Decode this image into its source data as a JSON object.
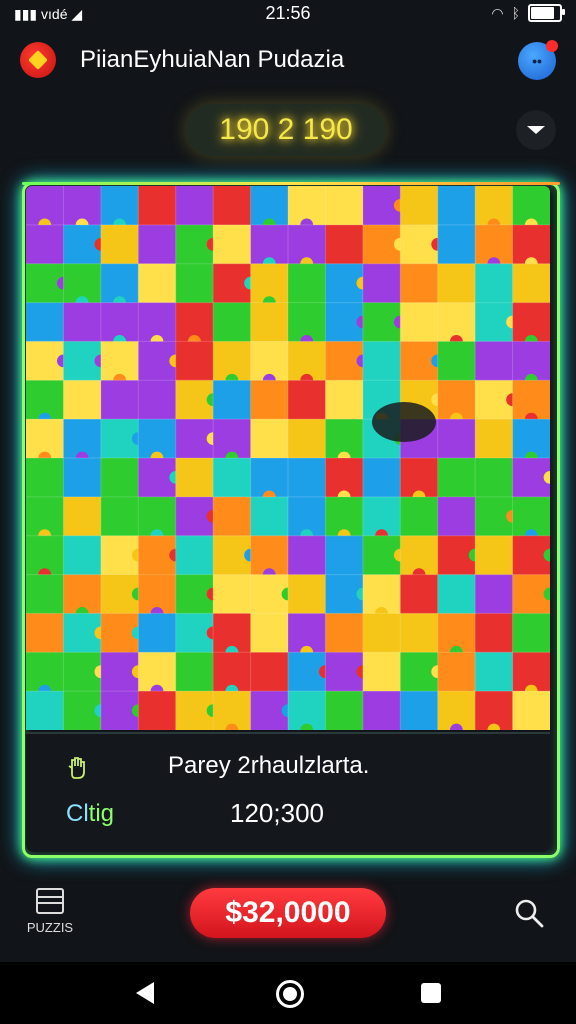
{
  "status": {
    "signal_text": "vıdé",
    "time": "21:56",
    "battery_level": 0.9
  },
  "header": {
    "title": "PiianEyhuiaNan Pudazia"
  },
  "score": {
    "value": "190 2 190"
  },
  "info": {
    "line1": "Parey 2rhaulzlarta.",
    "line2_label_a": "Cl",
    "line2_label_b": "tig",
    "line2_value": "120;300"
  },
  "bottom": {
    "puzzles_label": "PUZZIS",
    "price_label": "$32,0000"
  },
  "colors": {
    "palette": [
      "#2ecc2e",
      "#f5c518",
      "#ff8c1a",
      "#9b3de0",
      "#1ea0e8",
      "#e8312e",
      "#1fd3c0",
      "#ffe04a"
    ],
    "accent_green": "#8dff6a",
    "price_red": "#ff2a36"
  },
  "icons": [
    "app-logo-icon",
    "avatar-icon",
    "chevron-down-icon",
    "hand-icon",
    "puzzle-box-icon",
    "search-icon",
    "nav-back-icon",
    "nav-home-icon",
    "nav-recent-icon",
    "wifi-icon",
    "battery-icon"
  ]
}
